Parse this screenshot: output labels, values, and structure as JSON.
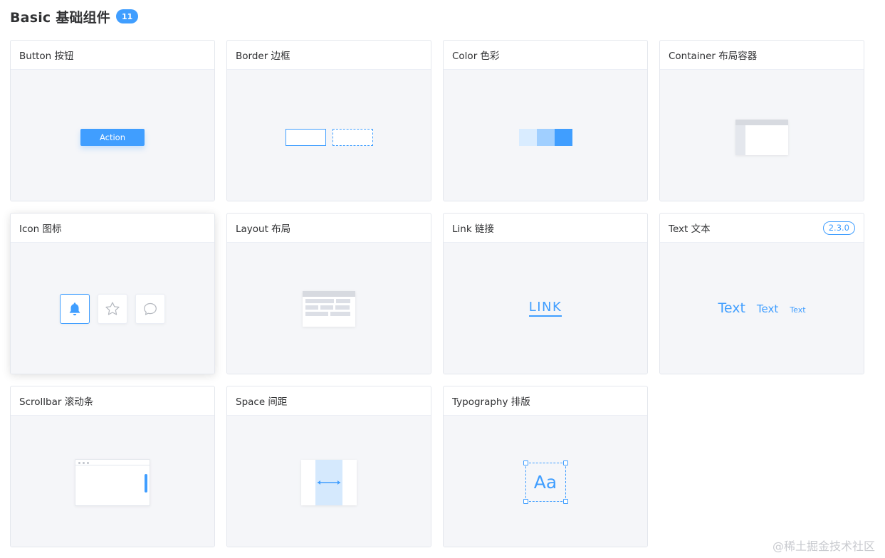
{
  "header": {
    "title": "Basic 基础组件",
    "count": "11"
  },
  "colors": {
    "accent": "#409eff",
    "card_body": "#f5f6f9",
    "border": "#e4e7ed"
  },
  "cards": [
    {
      "title": "Button 按钮",
      "demo": "button",
      "button_label": "Action"
    },
    {
      "title": "Border 边框",
      "demo": "border"
    },
    {
      "title": "Color 色彩",
      "demo": "color",
      "swatches": [
        "#d9ecff",
        "#a0cfff",
        "#409eff"
      ]
    },
    {
      "title": "Container 布局容器",
      "demo": "container"
    },
    {
      "title": "Icon 图标",
      "demo": "icon",
      "icons": [
        "bell-icon",
        "star-icon",
        "chat-bubble-icon"
      ]
    },
    {
      "title": "Layout 布局",
      "demo": "layout"
    },
    {
      "title": "Link 链接",
      "demo": "link",
      "link_text": "LINK"
    },
    {
      "title": "Text 文本",
      "demo": "text",
      "version": "2.3.0",
      "samples": [
        "Text",
        "Text",
        "Text"
      ]
    },
    {
      "title": "Scrollbar 滚动条",
      "demo": "scrollbar"
    },
    {
      "title": "Space 间距",
      "demo": "space"
    },
    {
      "title": "Typography 排版",
      "demo": "typography",
      "sample": "Aa"
    }
  ],
  "watermark": "@稀土掘金技术社区"
}
